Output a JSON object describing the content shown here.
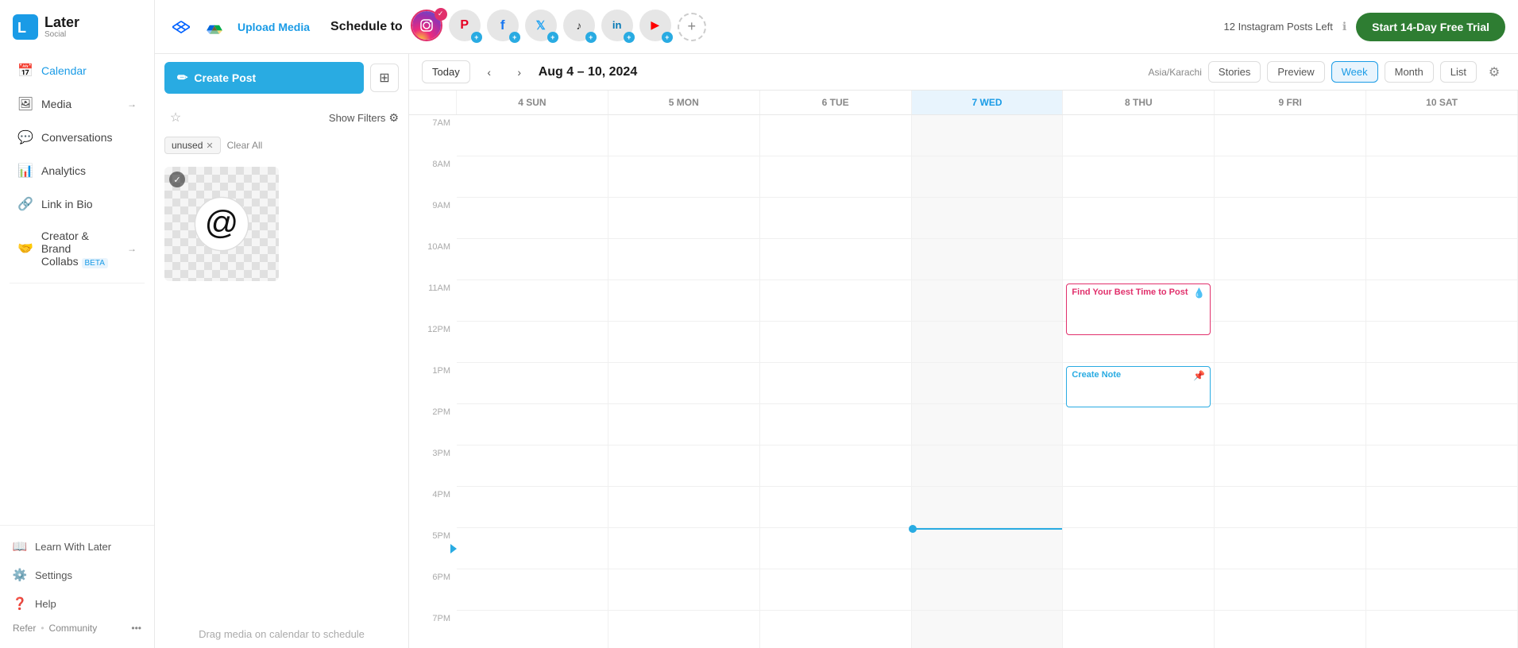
{
  "sidebar": {
    "logo": {
      "brand": "Later",
      "sub": "Social"
    },
    "nav_items": [
      {
        "id": "calendar",
        "label": "Calendar",
        "icon": "📅",
        "active": true
      },
      {
        "id": "media",
        "label": "Media",
        "icon": "🖼",
        "arrow": true
      },
      {
        "id": "conversations",
        "label": "Conversations",
        "icon": "💬"
      },
      {
        "id": "analytics",
        "label": "Analytics",
        "icon": "📊"
      },
      {
        "id": "link-in-bio",
        "label": "Link in Bio",
        "icon": "🔗"
      },
      {
        "id": "creator-brand",
        "label": "Creator & Brand Collabs",
        "badge": "BETA",
        "icon": "🤝",
        "arrow": true
      }
    ],
    "bottom_items": [
      {
        "id": "learn",
        "label": "Learn With Later",
        "icon": "📖"
      },
      {
        "id": "settings",
        "label": "Settings",
        "icon": "⚙️"
      },
      {
        "id": "help",
        "label": "Help",
        "icon": "❓"
      }
    ],
    "refer_label": "Refer",
    "community_label": "Community",
    "more_icon": "•••"
  },
  "header": {
    "upload_media_label": "Upload Media",
    "schedule_to_label": "Schedule to",
    "posts_left": "12 Instagram Posts Left",
    "trial_btn_label": "Start 14-Day Free Trial",
    "social_icons": [
      {
        "id": "instagram",
        "icon": "📷",
        "active": true,
        "has_check": true
      },
      {
        "id": "pinterest",
        "icon": "📌",
        "has_add": true
      },
      {
        "id": "facebook",
        "icon": "f",
        "has_add": true
      },
      {
        "id": "twitter",
        "icon": "🐦",
        "has_add": true
      },
      {
        "id": "tiktok",
        "icon": "♪",
        "has_add": true
      },
      {
        "id": "linkedin",
        "icon": "in",
        "has_add": true
      },
      {
        "id": "youtube",
        "icon": "▶",
        "has_add": true
      },
      {
        "id": "add_new",
        "icon": "+",
        "is_add_btn": true
      }
    ]
  },
  "left_panel": {
    "create_post_label": "Create Post",
    "filter_label": "Show Filters",
    "active_filter": "unused",
    "clear_all_label": "Clear All",
    "drag_hint": "Drag media on calendar to schedule",
    "media_items": [
      {
        "id": "threads-logo",
        "has_check": true
      }
    ]
  },
  "calendar": {
    "today_label": "Today",
    "date_range": "Aug 4 – 10, 2024",
    "timezone": "Asia/Karachi",
    "view_options": [
      "Stories",
      "Preview",
      "Week",
      "Month",
      "List"
    ],
    "active_view": "Week",
    "day_headers": [
      {
        "label": "4 SUN",
        "id": "sun"
      },
      {
        "label": "5 MON",
        "id": "mon"
      },
      {
        "label": "6 TUE",
        "id": "tue"
      },
      {
        "label": "7 WED",
        "id": "wed",
        "is_today": true
      },
      {
        "label": "8 THU",
        "id": "thu"
      },
      {
        "label": "9 FRI",
        "id": "fri"
      },
      {
        "label": "10 SAT",
        "id": "sat"
      }
    ],
    "time_slots": [
      "7AM",
      "8AM",
      "9AM",
      "10AM",
      "11AM",
      "12PM",
      "1PM",
      "2PM",
      "3PM",
      "4PM",
      "5PM",
      "6PM",
      "7PM"
    ],
    "events": [
      {
        "id": "best-time",
        "label": "Find Your Best Time to Post",
        "type": "best-time",
        "day": "thu",
        "time_slot": "11AM",
        "icon": "💧"
      },
      {
        "id": "create-note",
        "label": "Create Note",
        "type": "create-note",
        "day": "thu",
        "time_slot": "1PM",
        "icon": "📌"
      }
    ]
  }
}
